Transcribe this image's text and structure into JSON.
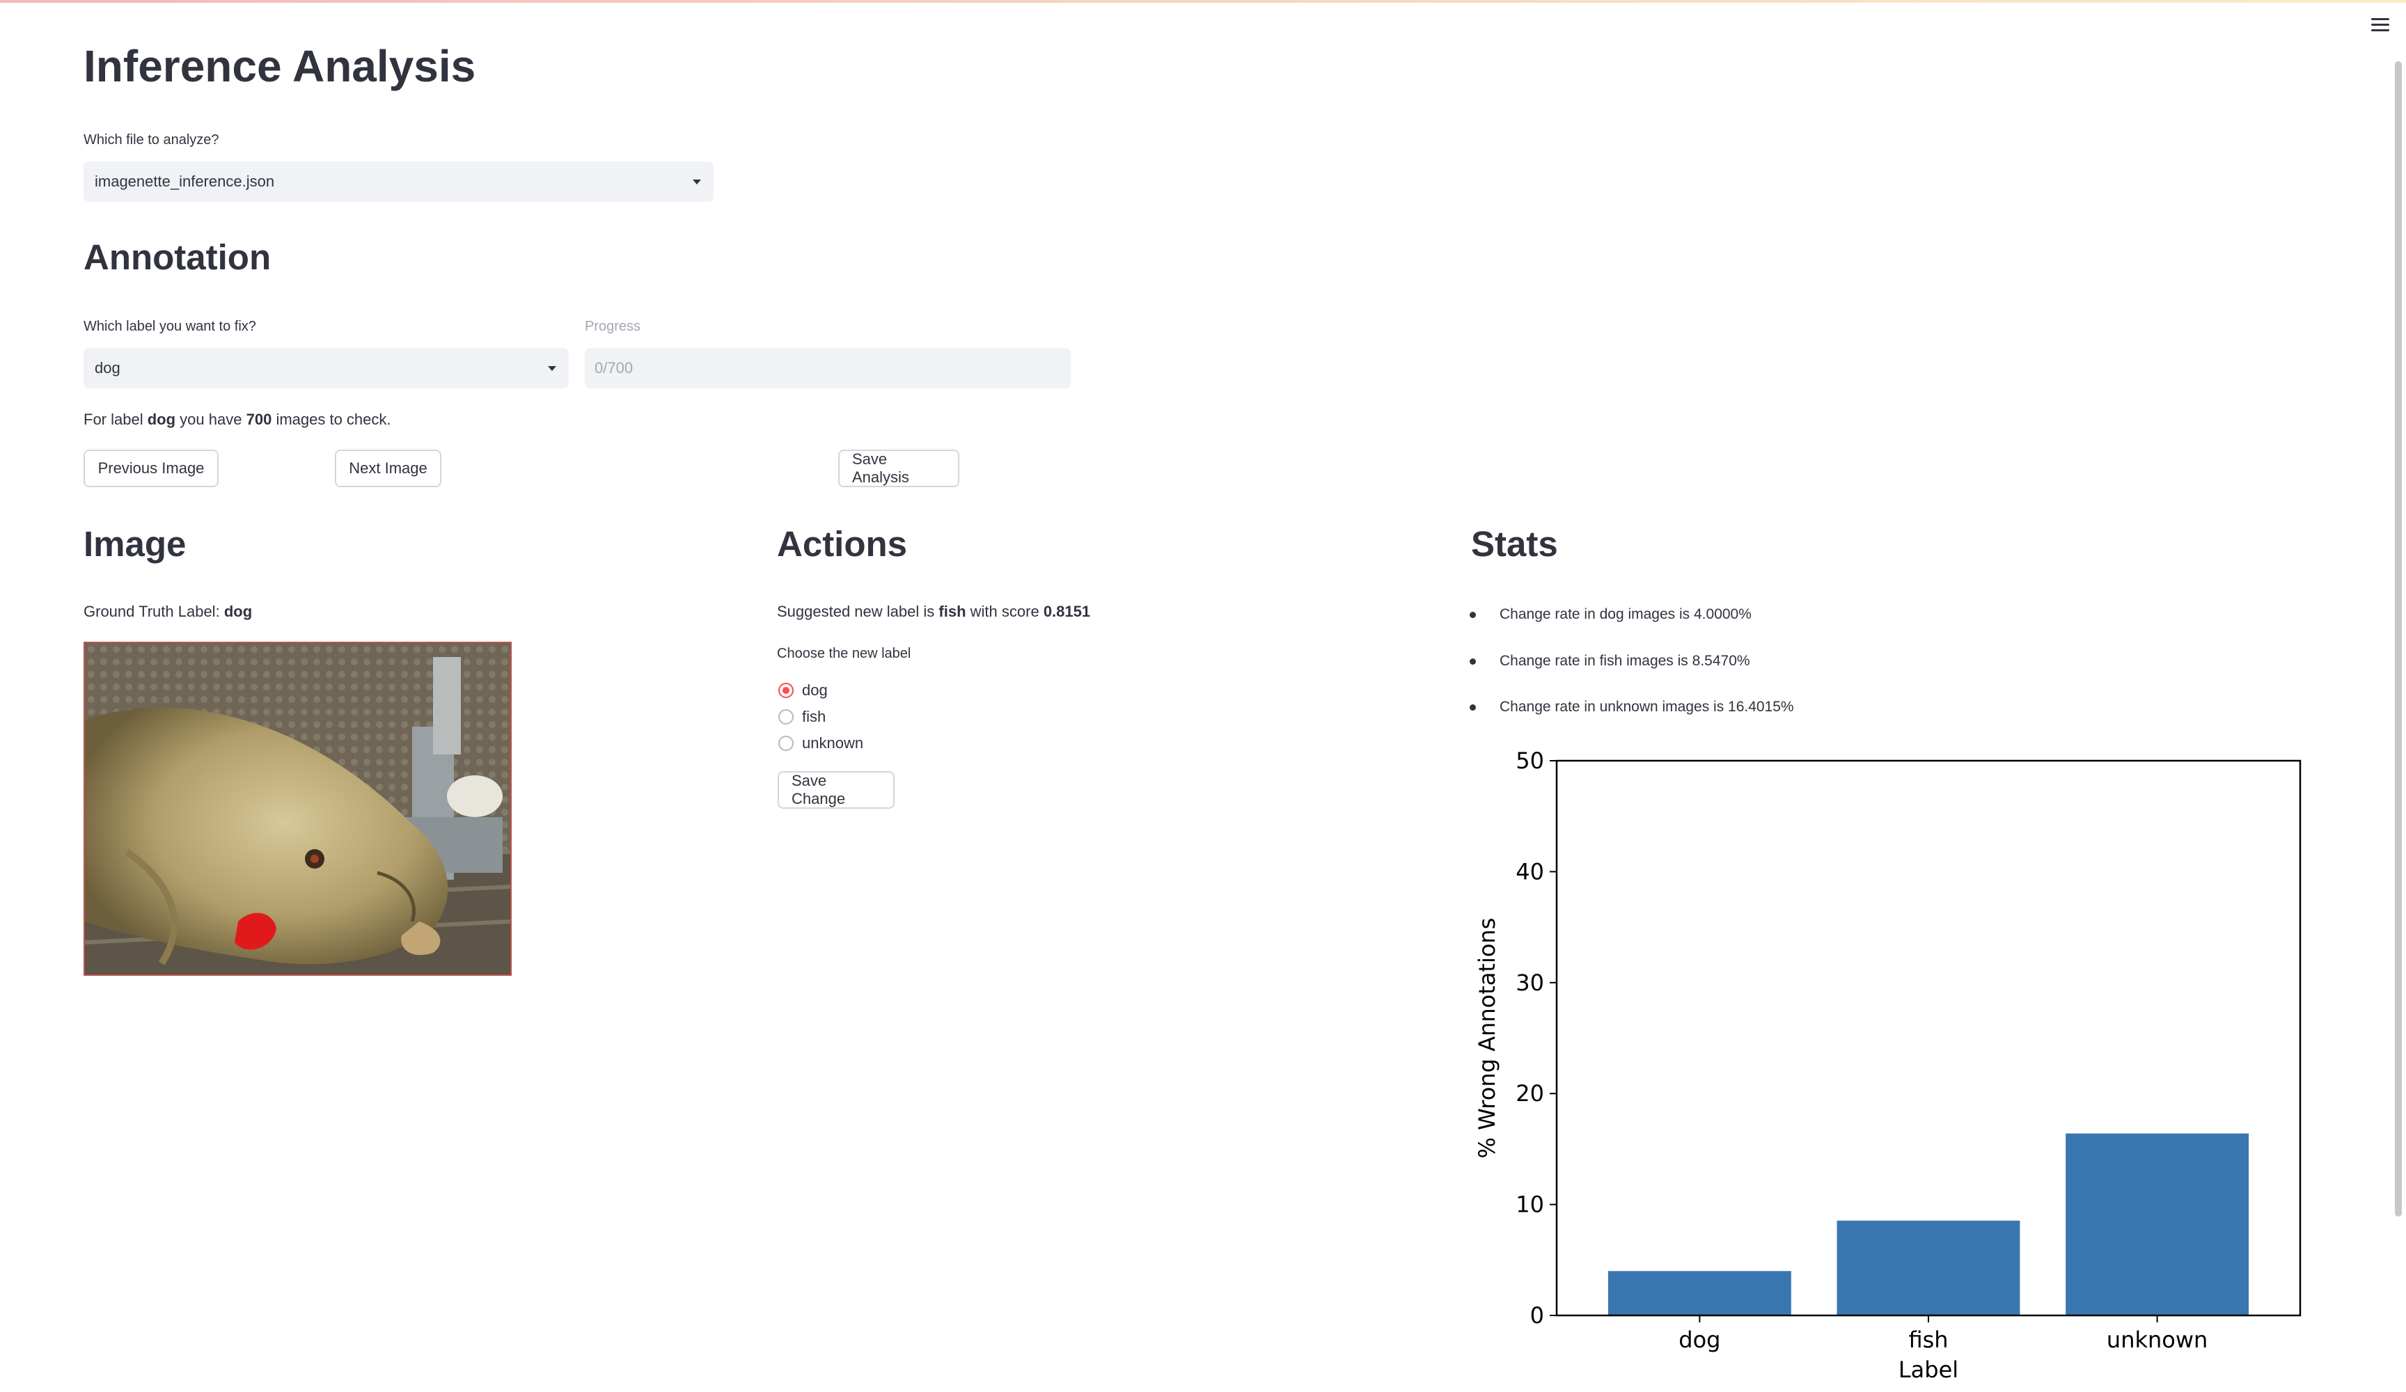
{
  "page": {
    "title": "Inference Analysis"
  },
  "file_select": {
    "label": "Which file to analyze?",
    "value": "imagenette_inference.json"
  },
  "annotation": {
    "heading": "Annotation",
    "label_select": {
      "label": "Which label you want to fix?",
      "value": "dog"
    },
    "progress": {
      "label": "Progress",
      "value": "0/700"
    },
    "summary": {
      "prefix": "For label",
      "label": "dog",
      "middle": "you have",
      "count": "700",
      "suffix": "images to check."
    },
    "buttons": {
      "previous": "Previous Image",
      "next": "Next Image",
      "save_analysis": "Save Analysis"
    }
  },
  "image_section": {
    "heading": "Image",
    "gt_prefix": "Ground Truth Label:",
    "gt_value": "dog"
  },
  "actions": {
    "heading": "Actions",
    "suggestion": {
      "prefix": "Suggested new label is",
      "label": "fish",
      "middle": "with score",
      "score": "0.8151"
    },
    "choose_label": "Choose the new label",
    "options": [
      {
        "label": "dog",
        "checked": true
      },
      {
        "label": "fish",
        "checked": false
      },
      {
        "label": "unknown",
        "checked": false
      }
    ],
    "save_change": "Save Change"
  },
  "stats": {
    "heading": "Stats",
    "items": [
      "Change rate in dog images is 4.0000%",
      "Change rate in fish images is 8.5470%",
      "Change rate in unknown images is 16.4015%"
    ]
  },
  "chart_data": {
    "type": "bar",
    "categories": [
      "dog",
      "fish",
      "unknown"
    ],
    "values": [
      4.0,
      8.547,
      16.4015
    ],
    "xlabel": "Label",
    "ylabel": "% Wrong Annotations",
    "ylim": [
      0,
      50
    ],
    "yticks": [
      0,
      10,
      20,
      30,
      40,
      50
    ],
    "bar_color": "#3a76af"
  },
  "colors": {
    "accent": "#ff4b4b",
    "text": "#31333f",
    "input_bg": "#f0f2f6"
  },
  "icons": {
    "menu": "hamburger-menu-icon",
    "dropdown": "caret-down-icon"
  }
}
